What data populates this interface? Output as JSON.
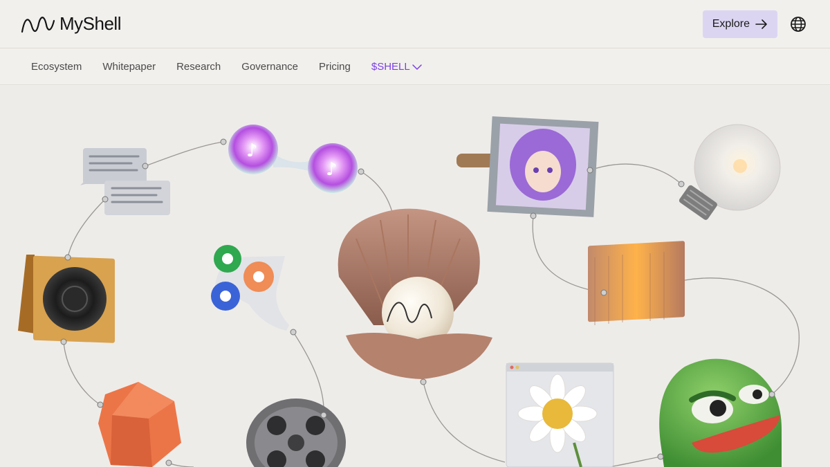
{
  "header": {
    "logo_text": "MyShell",
    "logo_icon": "myshell-wave-logo",
    "explore_label": "Explore",
    "explore_icon": "arrow-right-icon",
    "language_icon": "globe-icon"
  },
  "nav": {
    "items": [
      {
        "label": "Ecosystem"
      },
      {
        "label": "Whitepaper"
      },
      {
        "label": "Research"
      },
      {
        "label": "Governance"
      },
      {
        "label": "Pricing"
      }
    ],
    "token_label": "$SHELL",
    "token_icon": "chevron-down-icon"
  },
  "colors": {
    "background": "#f2f0ed",
    "accent_purple": "#7b3fe4",
    "explore_bg": "#dcd5f2"
  },
  "hero": {
    "illustrations": [
      "chat-bubbles",
      "music-orbs",
      "speaker",
      "lottery-balls-funnel",
      "shell-with-pearl",
      "anime-portrait-frame",
      "light-bulb",
      "glowing-heater",
      "twenty-sided-die",
      "film-reel",
      "daisy-window",
      "pepe-frog"
    ]
  }
}
